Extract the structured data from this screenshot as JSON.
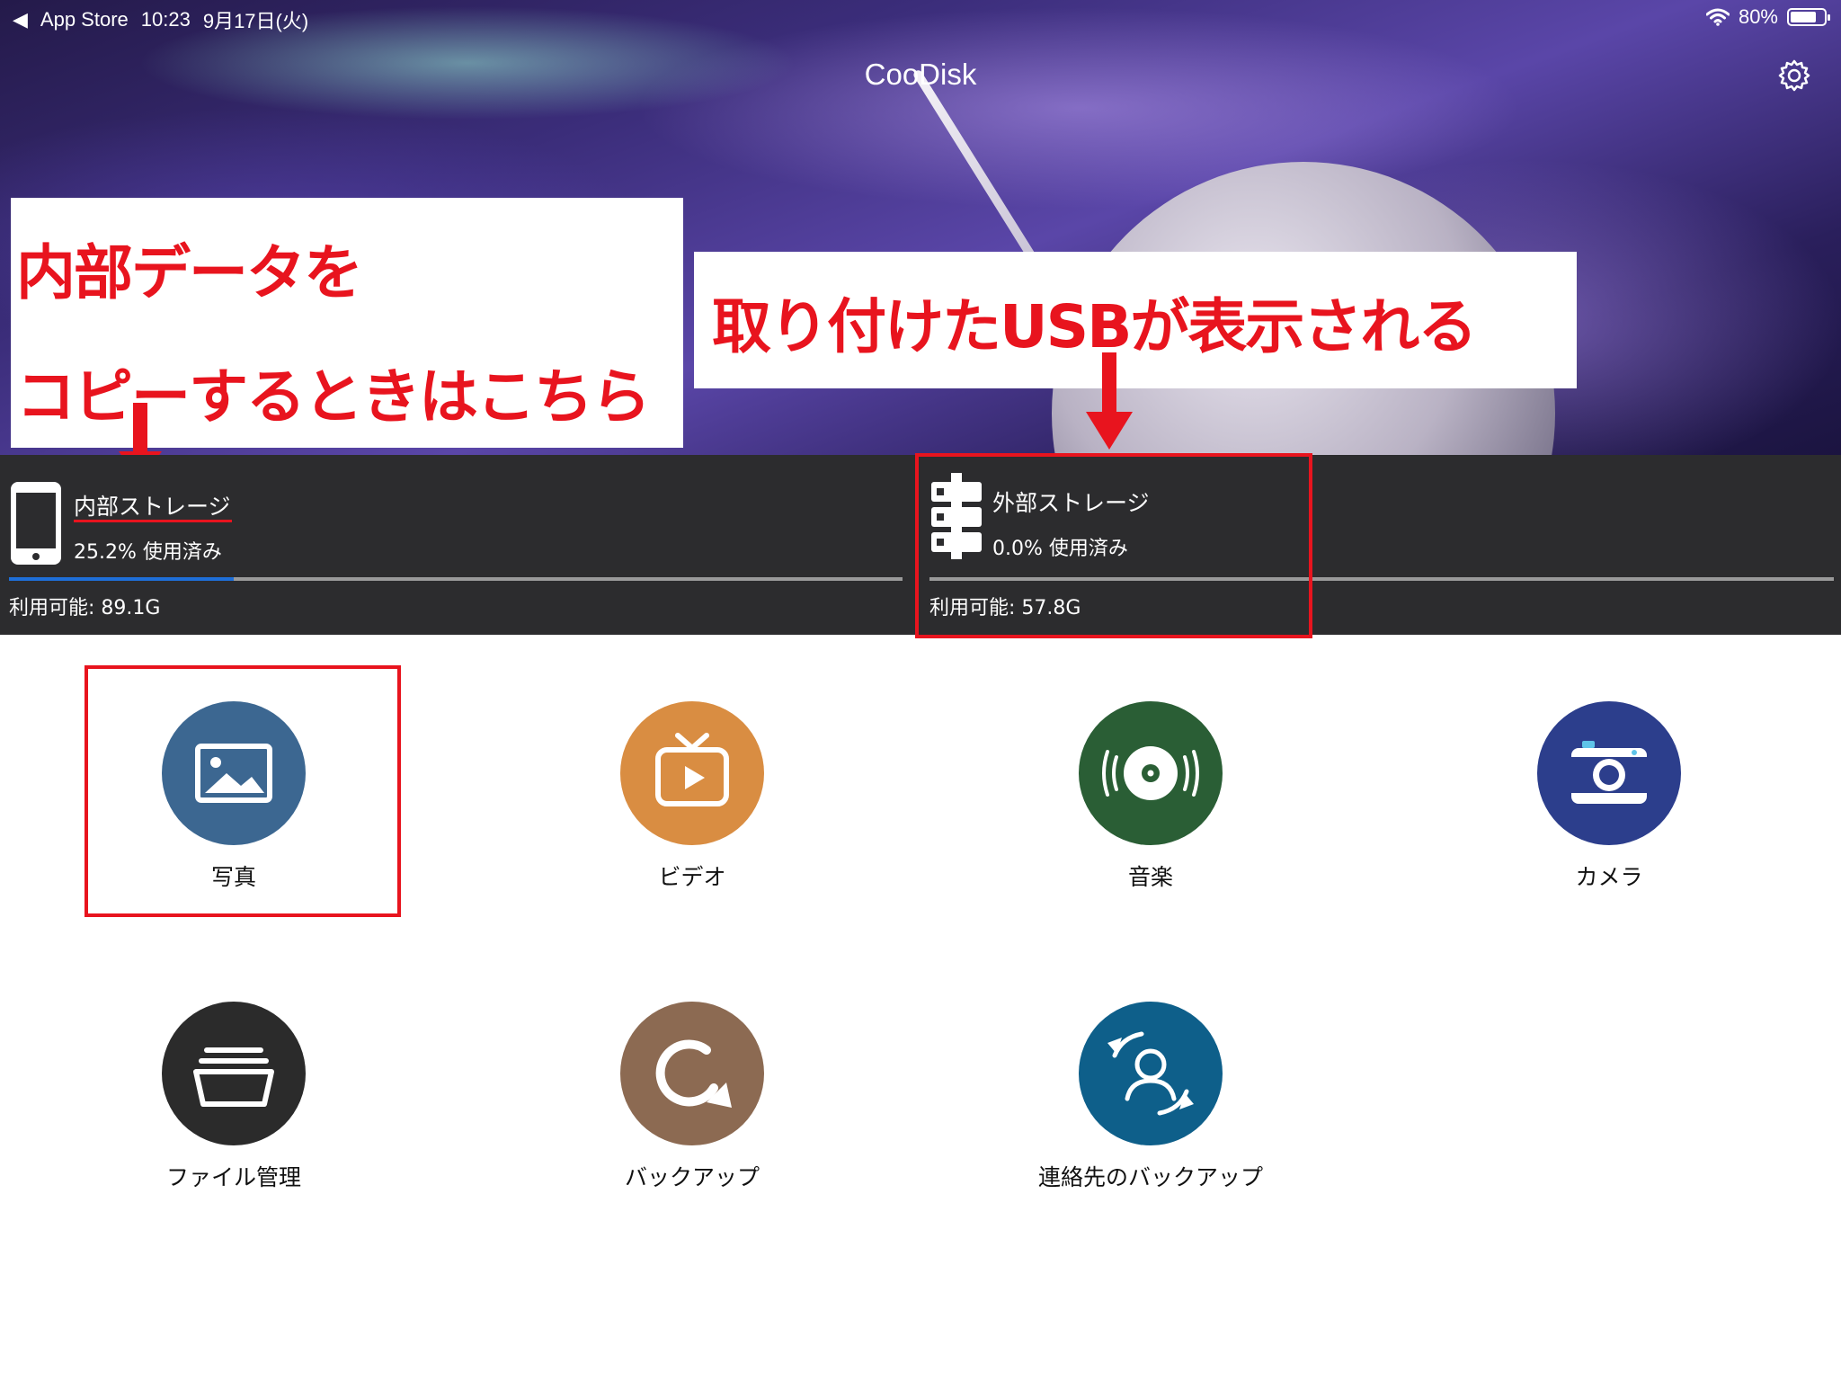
{
  "status_bar": {
    "back_app": "App Store",
    "time": "10:23",
    "date": "9月17日(火)",
    "battery": "80%",
    "battery_level": 0.8
  },
  "header": {
    "title": "CooDisk",
    "settings_icon": "gear-icon"
  },
  "annotations": {
    "left_line1": "内部データを",
    "left_line2": "コピーするときはこちら",
    "right_line1": "取り付けたUSBが表示される",
    "color": "#e8141e"
  },
  "storage": {
    "internal": {
      "name": "内部ストレージ",
      "used": "25.2% 使用済み",
      "used_fraction": 0.252,
      "available": "利用可能: 89.1G",
      "icon": "phone-icon"
    },
    "external": {
      "name": "外部ストレージ",
      "used": "0.0% 使用済み",
      "used_fraction": 0.0,
      "available": "利用可能: 57.8G",
      "icon": "server-icon"
    },
    "bar_color": "#1e6fd9"
  },
  "apps": [
    {
      "label": "写真",
      "icon": "photo-icon",
      "color": "#3c6791"
    },
    {
      "label": "ビデオ",
      "icon": "tv-play-icon",
      "color": "#d98d42"
    },
    {
      "label": "音楽",
      "icon": "vinyl-disc-icon",
      "color": "#2a5e35"
    },
    {
      "label": "カメラ",
      "icon": "camera-icon",
      "color": "#2c3e8c"
    },
    {
      "label": "ファイル管理",
      "icon": "folder-icon",
      "color": "#2b2b2b"
    },
    {
      "label": "バックアップ",
      "icon": "backup-icon",
      "color": "#8c6a52"
    },
    {
      "label": "連絡先のバックアップ",
      "icon": "contacts-sync-icon",
      "color": "#0e5f8a"
    }
  ]
}
